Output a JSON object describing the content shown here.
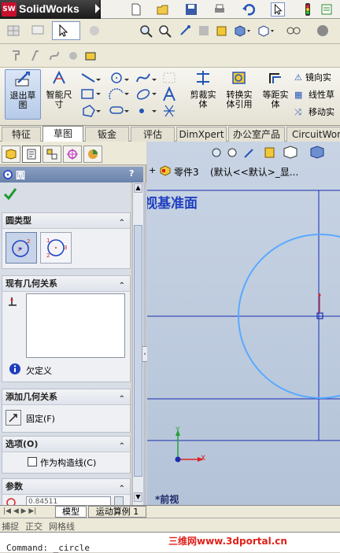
{
  "app": {
    "badge": "SW",
    "name": "SolidWorks"
  },
  "ribbon": {
    "exit_sketch": "退出草\n图",
    "smart_dim": "智能尺\n寸",
    "trim": "剪裁实\n体",
    "convert": "转换实\n体引用",
    "offset": "等距实\n体",
    "mirror": "镜向实",
    "linear_pattern": "线性草",
    "move": "移动实"
  },
  "tabs": [
    "特征",
    "草图",
    "钣金",
    "评估",
    "DimXpert",
    "办公室产品",
    "CircuitWorks"
  ],
  "active_tab": "草图",
  "property_manager": {
    "title": "圆",
    "help": "?",
    "groups": {
      "circle_type": {
        "title": "圆类型"
      },
      "existing_relations": {
        "title": "现有几何关系",
        "status": "欠定义"
      },
      "add_relations": {
        "title": "添加几何关系",
        "fix_label": "固定(F)"
      },
      "options": {
        "title": "选项(O)",
        "construction_label": "作为构造线(C)"
      },
      "params": {
        "title": "参数",
        "value": "0.84511"
      }
    }
  },
  "viewport": {
    "plane_label": "视基准面",
    "tree_item": "零件3",
    "config_text": "(默认<<默认>_显...",
    "view_label": "*前视",
    "axis_y": "Y",
    "axis_x": "X"
  },
  "bottom_tabs": [
    "模型",
    "运动算例 1"
  ],
  "status": [
    "捕捉",
    "正交",
    "网格线"
  ],
  "command_line": "Command: _circle",
  "watermark": "三维网www.3dportal.cn",
  "colors": {
    "accent_blue": "#1f3fbf",
    "circle_blue": "#5aa9ff",
    "watermark_red": "#e0201a"
  }
}
